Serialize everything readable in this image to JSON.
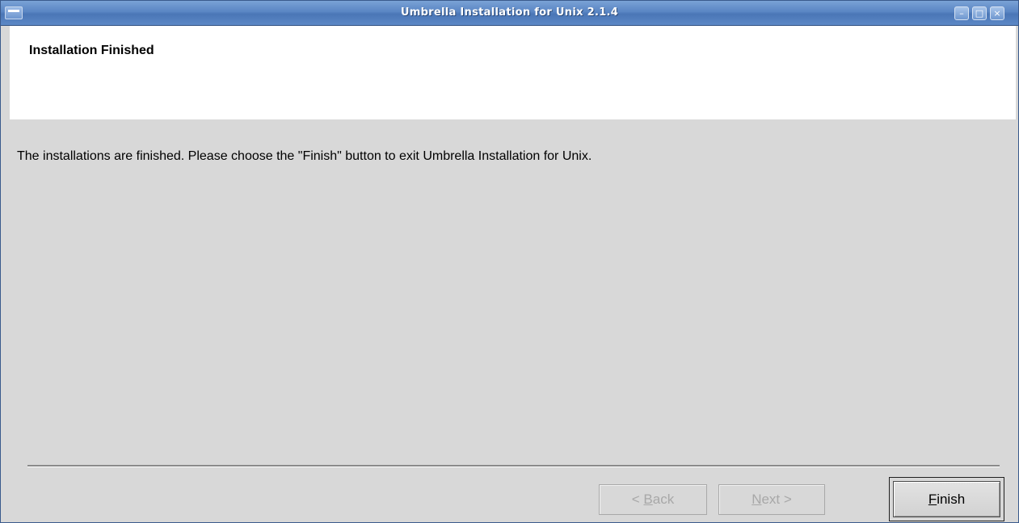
{
  "window": {
    "title": "Umbrella Installation for Unix 2.1.4",
    "minimize_glyph": "–",
    "maximize_glyph": "□",
    "close_glyph": "×"
  },
  "header": {
    "title": "Installation Finished"
  },
  "main": {
    "message": "The installations are finished. Please choose the \"Finish\" button to exit Umbrella Installation for Unix."
  },
  "buttons": {
    "back": {
      "mnemonic": "B",
      "label_pre": "< ",
      "label_rest": "ack",
      "enabled": false
    },
    "next": {
      "mnemonic": "N",
      "label_pre": "",
      "label_rest": "ext >",
      "enabled": false
    },
    "finish": {
      "mnemonic": "F",
      "label_pre": "",
      "label_rest": "inish",
      "enabled": true
    }
  },
  "icons": {
    "window_menu": "window-menu-icon",
    "minimize": "minimize-icon",
    "maximize": "maximize-icon",
    "close": "close-icon"
  },
  "colors": {
    "titlebar": "#5a86c4",
    "window_bg": "#d8d8d8",
    "header_bg": "#ffffff",
    "disabled_text": "#a8a8a8"
  }
}
